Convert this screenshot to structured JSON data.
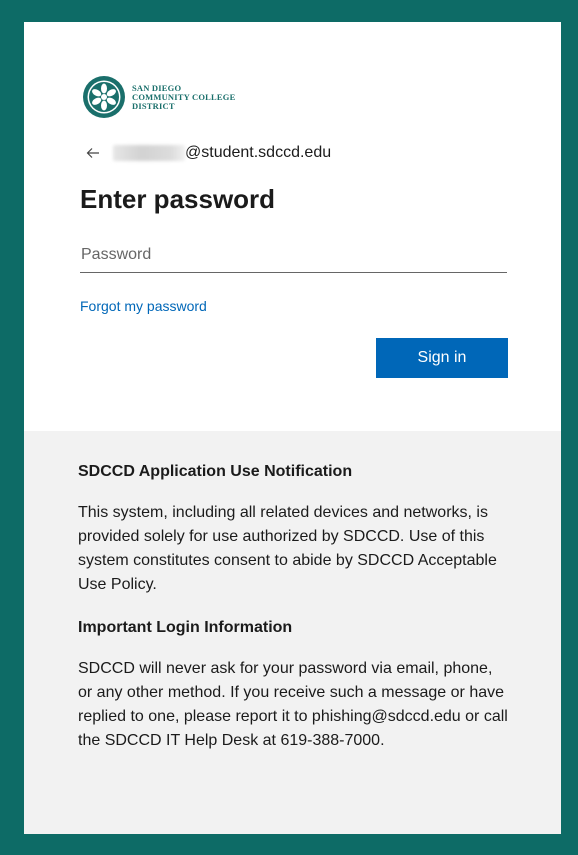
{
  "logo": {
    "line1": "SAN DIEGO",
    "line2": "COMMUNITY COLLEGE",
    "line3": "DISTRICT",
    "color": "#1a6f6b"
  },
  "account": {
    "back_icon": "back-arrow-icon",
    "email_domain": "@student.sdccd.edu"
  },
  "form": {
    "title": "Enter password",
    "password_placeholder": "Password",
    "password_value": "",
    "forgot_link": "Forgot my password",
    "signin_label": "Sign in",
    "accent_color": "#0067b8"
  },
  "notice": {
    "heading1": "SDCCD Application Use Notification",
    "body1": "This system, including all related devices and networks, is provided solely for use authorized by SDCCD. Use of this system constitutes consent to abide by SDCCD Acceptable Use Policy.",
    "heading2": "Important Login Information",
    "body2": "SDCCD will never ask for your password via email, phone, or any other method. If you receive such a message or have replied to one, please report it to phishing@sdccd.edu or call the SDCCD IT Help Desk at 619-388-7000."
  },
  "colors": {
    "background": "#0d6b66",
    "panel": "#ffffff",
    "notice_panel": "#f2f2f2"
  }
}
